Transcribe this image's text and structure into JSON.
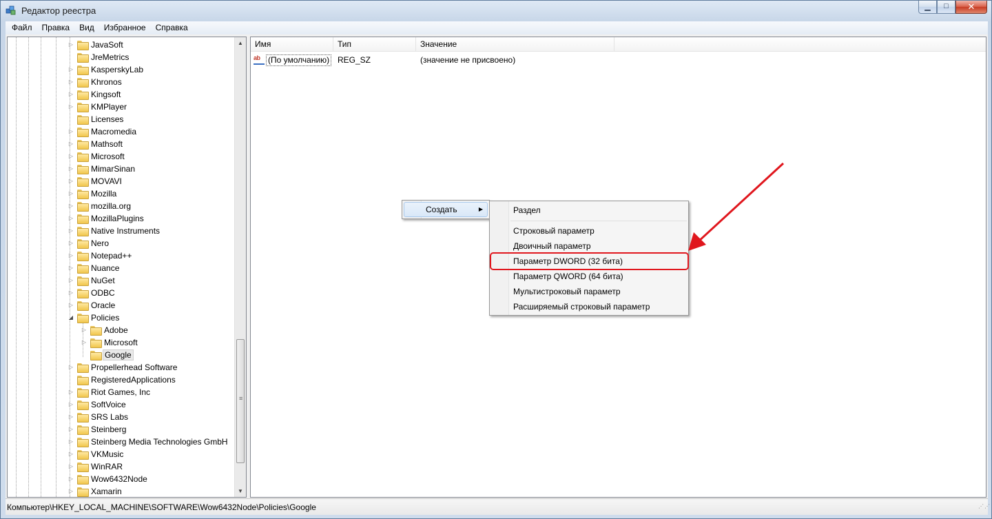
{
  "window": {
    "title": "Редактор реестра",
    "minimize_glyph": "▁",
    "maximize_glyph": "□",
    "close_glyph": "✕"
  },
  "menubar": [
    "Файл",
    "Правка",
    "Вид",
    "Избранное",
    "Справка"
  ],
  "tree": {
    "items": [
      {
        "label": "JavaSoft",
        "expandable": true
      },
      {
        "label": "JreMetrics",
        "expandable": false
      },
      {
        "label": "KasperskyLab",
        "expandable": true
      },
      {
        "label": "Khronos",
        "expandable": true
      },
      {
        "label": "Kingsoft",
        "expandable": true
      },
      {
        "label": "KMPlayer",
        "expandable": true
      },
      {
        "label": "Licenses",
        "expandable": false
      },
      {
        "label": "Macromedia",
        "expandable": true
      },
      {
        "label": "Mathsoft",
        "expandable": true
      },
      {
        "label": "Microsoft",
        "expandable": true
      },
      {
        "label": "MimarSinan",
        "expandable": true
      },
      {
        "label": "MOVAVI",
        "expandable": true
      },
      {
        "label": "Mozilla",
        "expandable": true
      },
      {
        "label": "mozilla.org",
        "expandable": true
      },
      {
        "label": "MozillaPlugins",
        "expandable": true
      },
      {
        "label": "Native Instruments",
        "expandable": true
      },
      {
        "label": "Nero",
        "expandable": true
      },
      {
        "label": "Notepad++",
        "expandable": true
      },
      {
        "label": "Nuance",
        "expandable": true
      },
      {
        "label": "NuGet",
        "expandable": true
      },
      {
        "label": "ODBC",
        "expandable": true
      },
      {
        "label": "Oracle",
        "expandable": true
      },
      {
        "label": "Policies",
        "expandable": true,
        "expanded": true
      },
      {
        "label": "Adobe",
        "expandable": true,
        "child": true
      },
      {
        "label": "Microsoft",
        "expandable": true,
        "child": true
      },
      {
        "label": "Google",
        "expandable": false,
        "child": true,
        "selected": true
      },
      {
        "label": "Propellerhead Software",
        "expandable": true
      },
      {
        "label": "RegisteredApplications",
        "expandable": false
      },
      {
        "label": "Riot Games, Inc",
        "expandable": true
      },
      {
        "label": "SoftVoice",
        "expandable": true
      },
      {
        "label": "SRS Labs",
        "expandable": true
      },
      {
        "label": "Steinberg",
        "expandable": true
      },
      {
        "label": "Steinberg Media Technologies GmbH",
        "expandable": true
      },
      {
        "label": "VKMusic",
        "expandable": true
      },
      {
        "label": "WinRAR",
        "expandable": true
      },
      {
        "label": "Wow6432Node",
        "expandable": true
      },
      {
        "label": "Xamarin",
        "expandable": true
      }
    ]
  },
  "list": {
    "columns": [
      "Имя",
      "Тип",
      "Значение"
    ],
    "rows": [
      {
        "name": "(По умолчанию)",
        "type": "REG_SZ",
        "value": "(значение не присвоено)",
        "icon": "ab"
      }
    ]
  },
  "context_menu": {
    "item": "Создать",
    "submenu_arrow": "▶"
  },
  "submenu": {
    "items": [
      "Раздел",
      "Строковый параметр",
      "Двоичный параметр",
      "Параметр DWORD (32 бита)",
      "Параметр QWORD (64 бита)",
      "Мультистроковый параметр",
      "Расширяемый строковый параметр"
    ],
    "highlighted_index": 3
  },
  "statusbar": {
    "path": "Компьютер\\HKEY_LOCAL_MACHINE\\SOFTWARE\\Wow6432Node\\Policies\\Google"
  },
  "colors": {
    "annotation_red": "#e0161d",
    "menu_hover": "#d9e8f8"
  }
}
